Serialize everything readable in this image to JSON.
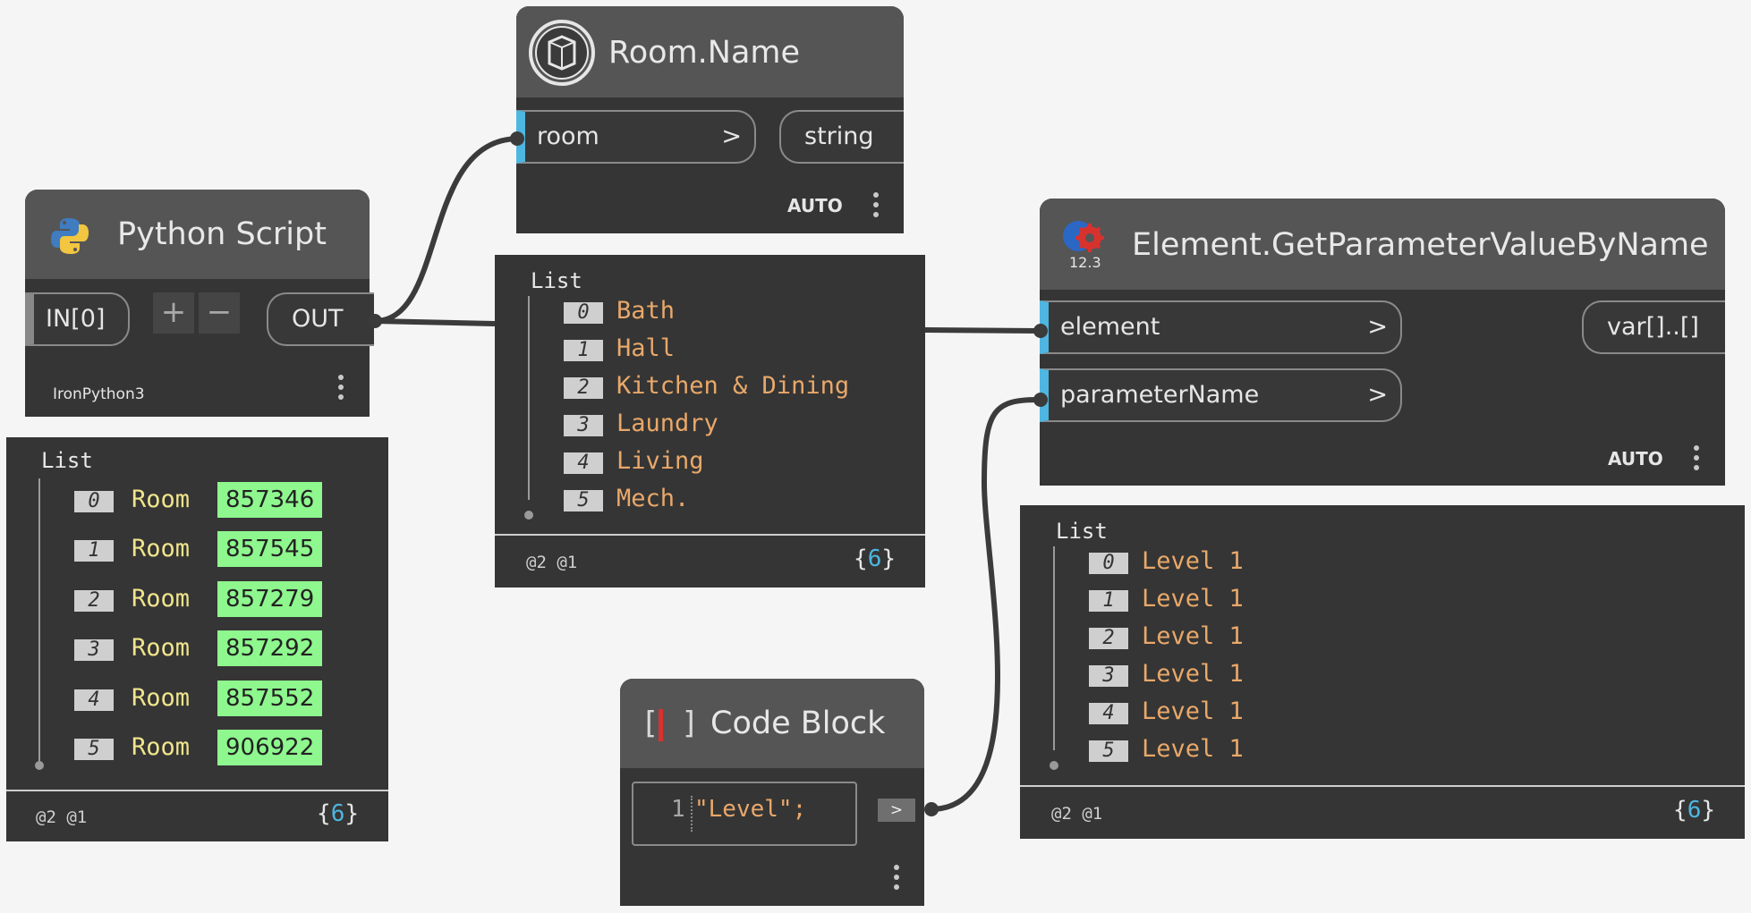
{
  "python_node": {
    "title": "Python Script",
    "input": "IN[0]",
    "add": "+",
    "remove": "−",
    "output": "OUT",
    "engine": "IronPython3",
    "preview": {
      "header": "List",
      "items": [
        {
          "index": "0",
          "type": "Room",
          "id": "857346"
        },
        {
          "index": "1",
          "type": "Room",
          "id": "857545"
        },
        {
          "index": "2",
          "type": "Room",
          "id": "857279"
        },
        {
          "index": "3",
          "type": "Room",
          "id": "857292"
        },
        {
          "index": "4",
          "type": "Room",
          "id": "857552"
        },
        {
          "index": "5",
          "type": "Room",
          "id": "906922"
        }
      ],
      "levels": "@2 @1",
      "count_open": "{",
      "count": "6",
      "count_close": "}"
    }
  },
  "room_name_node": {
    "title": "Room.Name",
    "input": "room",
    "input_arrow": ">",
    "output": "string",
    "lacing": "AUTO",
    "preview": {
      "header": "List",
      "items": [
        {
          "index": "0",
          "value": "Bath"
        },
        {
          "index": "1",
          "value": "Hall"
        },
        {
          "index": "2",
          "value": "Kitchen & Dining"
        },
        {
          "index": "3",
          "value": "Laundry"
        },
        {
          "index": "4",
          "value": "Living"
        },
        {
          "index": "5",
          "value": "Mech."
        }
      ],
      "levels": "@2 @1",
      "count_open": "{",
      "count": "6",
      "count_close": "}"
    }
  },
  "get_param_node": {
    "title": "Element.GetParameterValueByName",
    "icon_badge": "12.3",
    "input_element": "element",
    "input_param": "parameterName",
    "input_arrow": ">",
    "output": "var[]..[]",
    "lacing": "AUTO",
    "preview": {
      "header": "List",
      "items": [
        {
          "index": "0",
          "value": "Level 1"
        },
        {
          "index": "1",
          "value": "Level 1"
        },
        {
          "index": "2",
          "value": "Level 1"
        },
        {
          "index": "3",
          "value": "Level 1"
        },
        {
          "index": "4",
          "value": "Level 1"
        },
        {
          "index": "5",
          "value": "Level 1"
        }
      ],
      "levels": "@2 @1",
      "count_open": "{",
      "count": "6",
      "count_close": "}"
    }
  },
  "code_block_node": {
    "title": "Code Block",
    "icon_text": "[ ]",
    "line_number": "1",
    "code": "\"Level\";",
    "output_arrow": ">"
  },
  "colors": {
    "canvas": "#f5f5f5",
    "node_body": "#353535",
    "node_header": "#555555",
    "input_accent": "#4eb6e0",
    "value_text": "#e9a86a",
    "element_text": "#f0e58c",
    "id_badge": "#8ef78e",
    "wire": "#3b3b3b"
  }
}
